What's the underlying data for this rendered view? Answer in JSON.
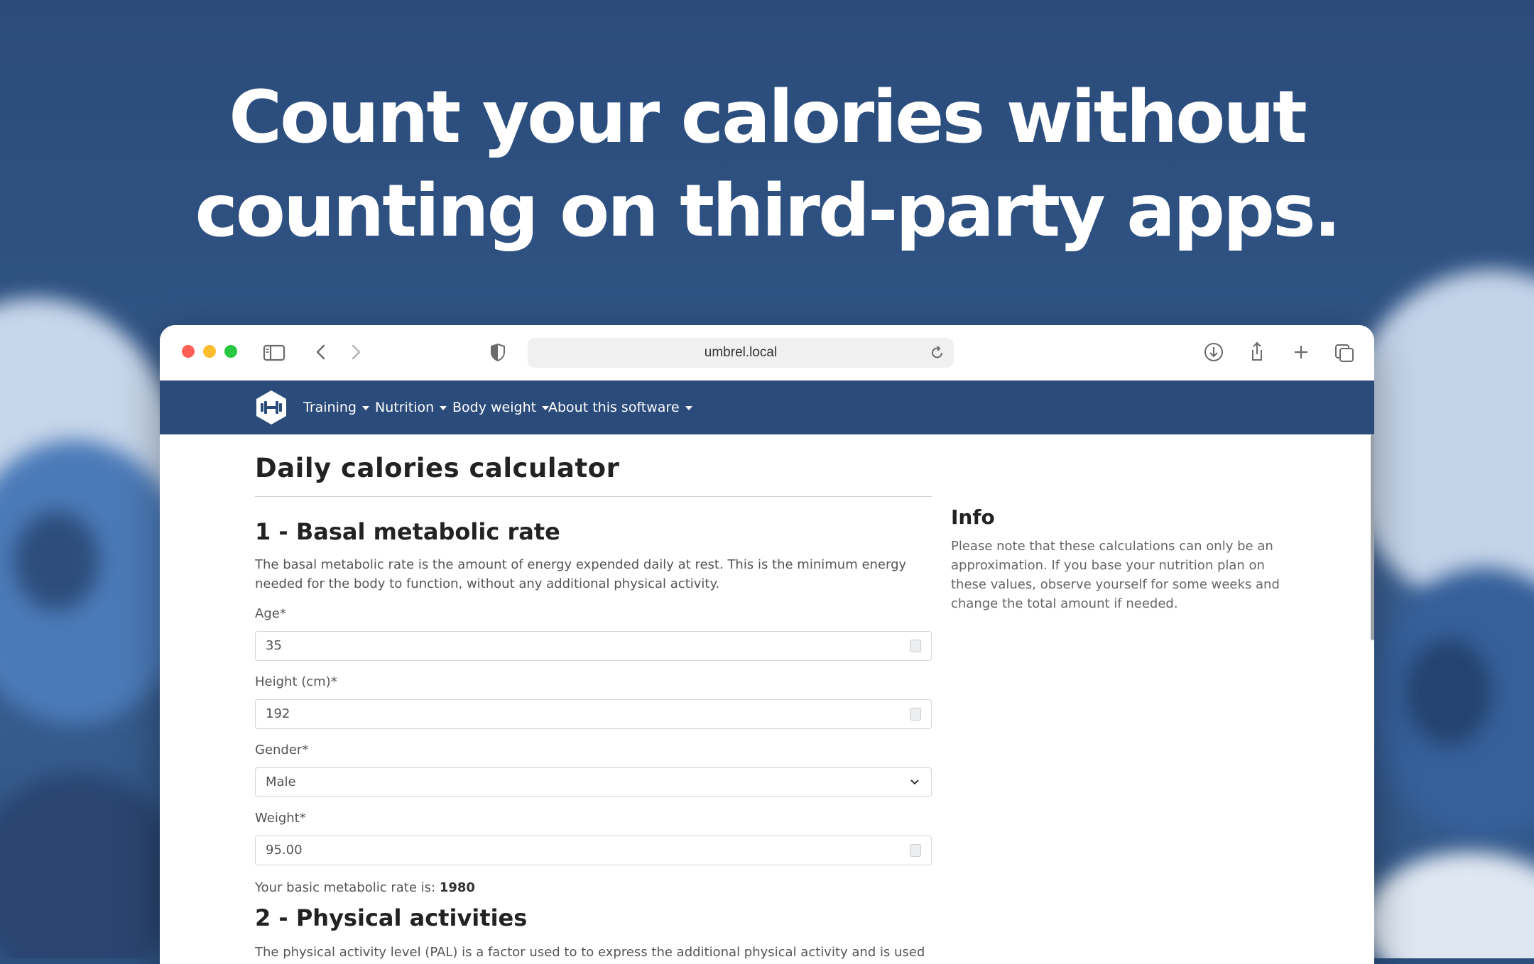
{
  "headline": {
    "line1": "Count your calories without",
    "line2": "counting on third-party apps."
  },
  "browser": {
    "url": "umbrel.local"
  },
  "navbar": {
    "items": [
      {
        "label": "Training"
      },
      {
        "label": "Nutrition"
      },
      {
        "label": "Body weight"
      },
      {
        "label": "About this software"
      }
    ]
  },
  "page": {
    "title": "Daily calories calculator",
    "section1": {
      "heading": "1 - Basal metabolic rate",
      "description": "The basal metabolic rate is the amount of energy expended daily at rest. This is the minimum energy needed for the body to function, without any additional physical activity.",
      "fields": {
        "age": {
          "label": "Age*",
          "value": "35"
        },
        "height": {
          "label": "Height (cm)*",
          "value": "192"
        },
        "gender": {
          "label": "Gender*",
          "value": "Male"
        },
        "weight": {
          "label": "Weight*",
          "value": "95.00"
        }
      },
      "result_prefix": "Your basic metabolic rate is:",
      "result_value": "1980"
    },
    "section2": {
      "heading": "2 - Physical activities",
      "description": "The physical activity level (PAL) is a factor used to to express the additional physical activity and is used to calculate the"
    },
    "info": {
      "heading": "Info",
      "text": "Please note that these calculations can only be an approximation. If you base your nutrition plan on these values, observe yourself for some weeks and change the total amount if needed."
    }
  },
  "colors": {
    "background": "#2c4f7d",
    "navbar": "#2b4c7b",
    "traffic_red": "#ff5f57",
    "traffic_yellow": "#febc2e",
    "traffic_green": "#28c840"
  },
  "icons": [
    "sidebar-icon",
    "back-icon",
    "forward-icon",
    "shield-icon",
    "reload-icon",
    "download-icon",
    "share-icon",
    "plus-icon",
    "tabs-icon",
    "dumbbell-logo-icon",
    "chevron-down-icon"
  ]
}
